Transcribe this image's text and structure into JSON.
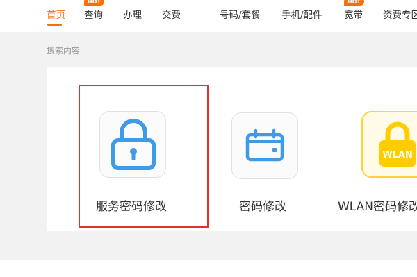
{
  "nav": {
    "items": [
      {
        "label": "首页",
        "active": true
      },
      {
        "label": "查询",
        "badge": "HOT"
      },
      {
        "label": "办理"
      },
      {
        "label": "交费"
      },
      {
        "label": "号码/套餐"
      },
      {
        "label": "手机/配件"
      },
      {
        "label": "宽带",
        "badge": "HOT"
      },
      {
        "label": "资费专区"
      }
    ]
  },
  "section": {
    "label": "搜索内容"
  },
  "tiles": [
    {
      "label": "服务密码修改",
      "icon": "lock-icon",
      "highlighted": true
    },
    {
      "label": "密码修改",
      "icon": "calendar-icon"
    },
    {
      "label": "WLAN密码修改",
      "icon": "wlan-lock-icon",
      "icon_text": "WLAN"
    }
  ],
  "colors": {
    "accent": "#ff6e00",
    "icon_blue": "#3d9be9",
    "wlan_yellow": "#ffcc00",
    "highlight": "#e03131"
  }
}
